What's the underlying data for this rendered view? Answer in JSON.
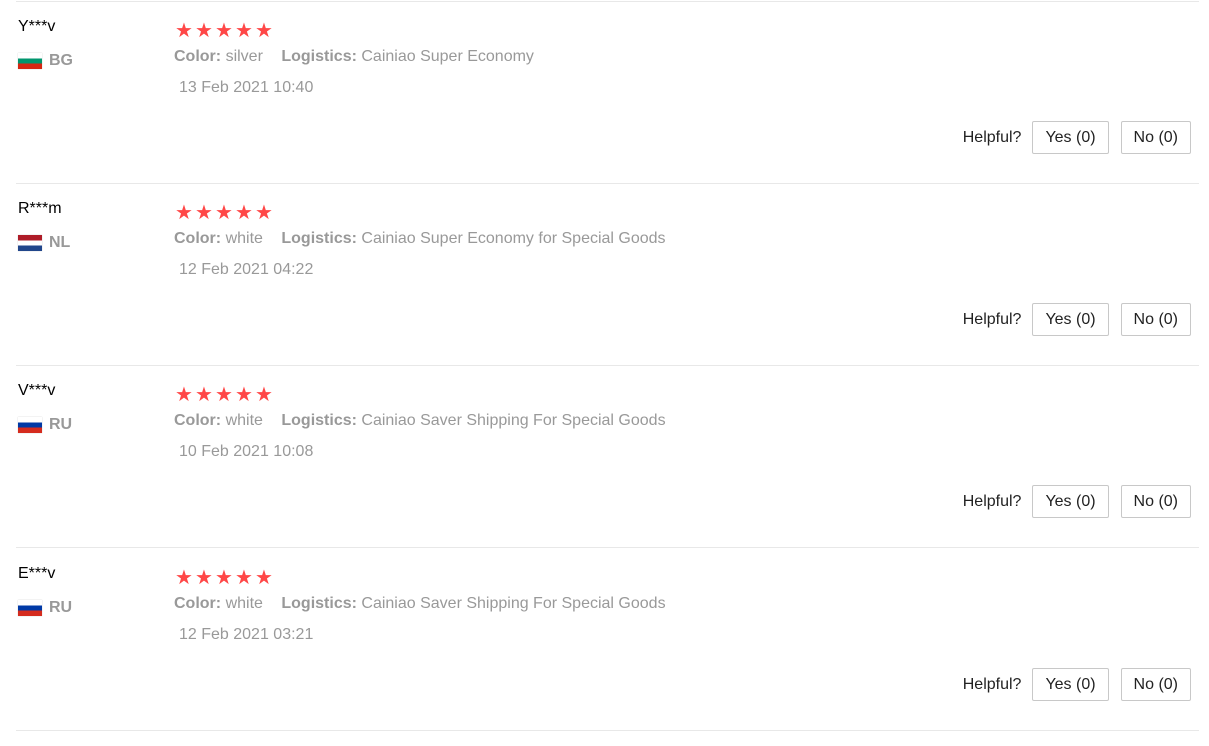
{
  "helpful_label": "Helpful?",
  "star_glyph": "★",
  "labels": {
    "color": "Color:",
    "logistics": "Logistics:"
  },
  "colors": {
    "star": "#ff4747",
    "muted_text": "#999999",
    "divider": "#e8e8e8"
  },
  "reviews": [
    {
      "user": "Y***v",
      "country": "BG",
      "flag_icon": "bulgaria-flag-icon",
      "rating": 5,
      "color": "silver",
      "logistics": "Cainiao Super Economy",
      "date": "13 Feb 2021 10:40",
      "yes": "Yes (0)",
      "no": "No (0)"
    },
    {
      "user": "R***m",
      "country": "NL",
      "flag_icon": "netherlands-flag-icon",
      "rating": 5,
      "color": "white",
      "logistics": "Cainiao Super Economy for Special Goods",
      "date": "12 Feb 2021 04:22",
      "yes": "Yes (0)",
      "no": "No (0)"
    },
    {
      "user": "V***v",
      "country": "RU",
      "flag_icon": "russia-flag-icon",
      "rating": 5,
      "color": "white",
      "logistics": "Cainiao Saver Shipping For Special Goods",
      "date": "10 Feb 2021 10:08",
      "yes": "Yes (0)",
      "no": "No (0)"
    },
    {
      "user": "E***v",
      "country": "RU",
      "flag_icon": "russia-flag-icon",
      "rating": 5,
      "color": "white",
      "logistics": "Cainiao Saver Shipping For Special Goods",
      "date": "12 Feb 2021 03:21",
      "yes": "Yes (0)",
      "no": "No (0)"
    }
  ]
}
